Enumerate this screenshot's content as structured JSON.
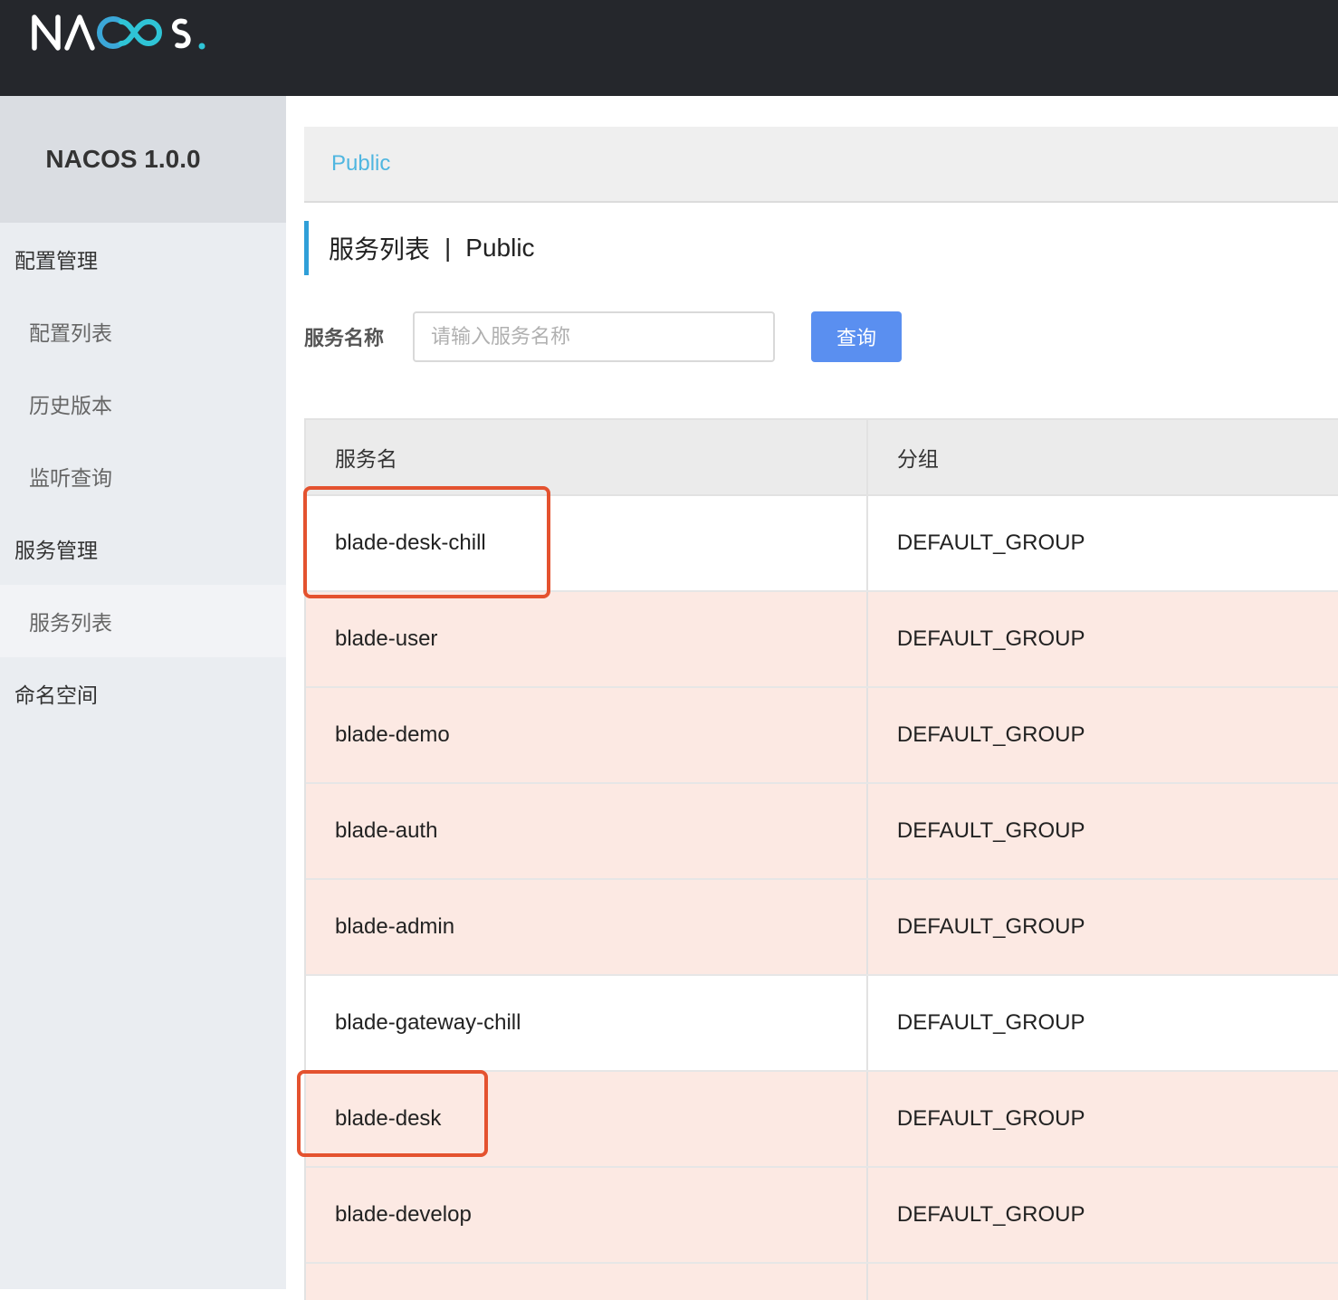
{
  "header": {
    "logo_text": "NACOS."
  },
  "sidebar": {
    "title": "NACOS 1.0.0",
    "items": [
      {
        "label": "配置管理",
        "type": "group"
      },
      {
        "label": "配置列表",
        "type": "sub"
      },
      {
        "label": "历史版本",
        "type": "sub"
      },
      {
        "label": "监听查询",
        "type": "sub"
      },
      {
        "label": "服务管理",
        "type": "group"
      },
      {
        "label": "服务列表",
        "type": "sub",
        "active": true
      },
      {
        "label": "命名空间",
        "type": "group"
      }
    ]
  },
  "breadcrumb": {
    "namespace": "Public"
  },
  "page": {
    "title": "服务列表",
    "separator": "|",
    "namespace": "Public"
  },
  "search": {
    "label": "服务名称",
    "placeholder": "请输入服务名称",
    "value": "",
    "button_label": "查询"
  },
  "table": {
    "columns": [
      "服务名",
      "分组"
    ],
    "rows": [
      {
        "service": "blade-desk-chill",
        "group": "DEFAULT_GROUP",
        "highlighted": true
      },
      {
        "service": "blade-user",
        "group": "DEFAULT_GROUP"
      },
      {
        "service": "blade-demo",
        "group": "DEFAULT_GROUP"
      },
      {
        "service": "blade-auth",
        "group": "DEFAULT_GROUP"
      },
      {
        "service": "blade-admin",
        "group": "DEFAULT_GROUP"
      },
      {
        "service": "blade-gateway-chill",
        "group": "DEFAULT_GROUP"
      },
      {
        "service": "blade-desk",
        "group": "DEFAULT_GROUP",
        "highlighted": true
      },
      {
        "service": "blade-develop",
        "group": "DEFAULT_GROUP"
      }
    ]
  },
  "colors": {
    "topbar": "#25272c",
    "sidebar": "#eaedf1",
    "accent": "#4fb6e0",
    "button": "#5a8ff0",
    "row_tint": "#fce9e3",
    "highlight_box": "#e4522f"
  }
}
